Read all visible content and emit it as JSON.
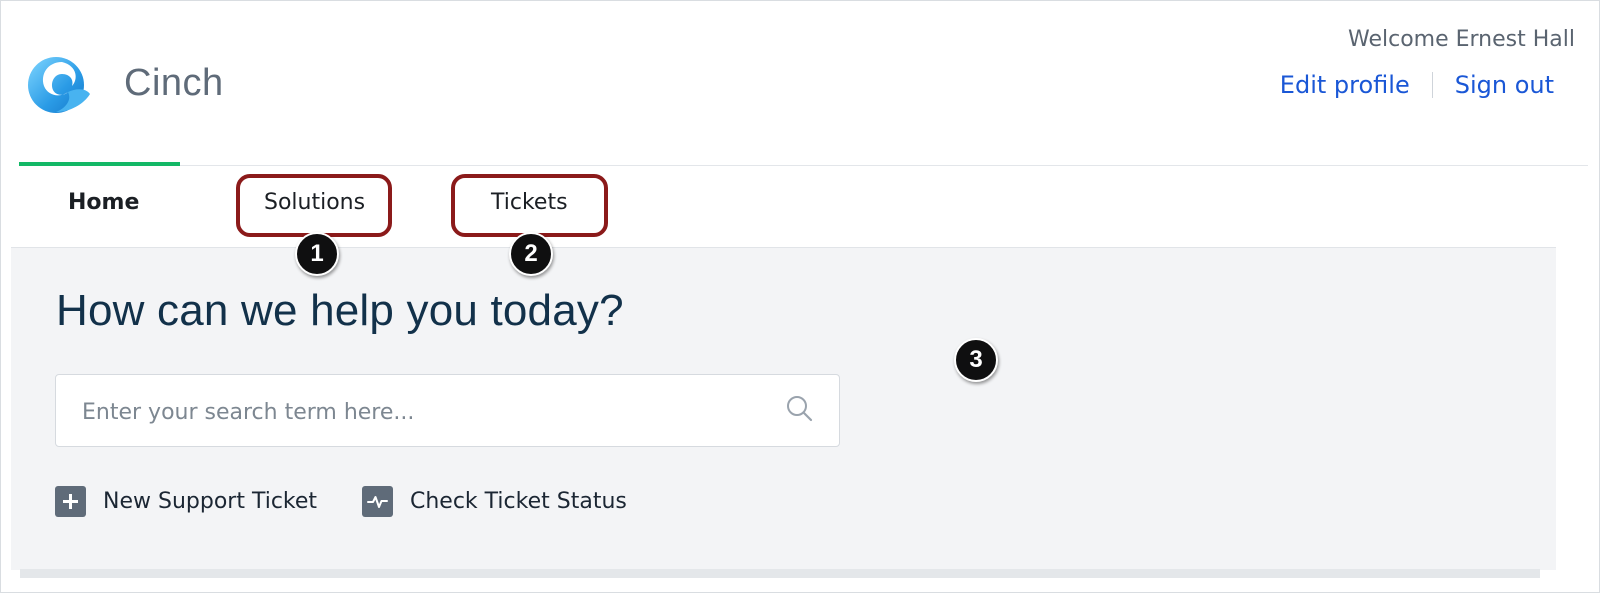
{
  "header": {
    "brand": "Cinch",
    "welcome": "Welcome Ernest Hall",
    "edit_profile": "Edit profile",
    "sign_out": "Sign out",
    "logo_icon": "wave-logo-icon"
  },
  "nav": {
    "tabs": [
      {
        "label": "Home",
        "active": true
      },
      {
        "label": "Solutions",
        "active": false
      },
      {
        "label": "Tickets",
        "active": false
      }
    ],
    "active_color": "#13b866"
  },
  "callouts": {
    "one": "1",
    "two": "2",
    "three": "3",
    "box_color": "#8b1a1a"
  },
  "main": {
    "heading": "How can we help you today?",
    "search": {
      "placeholder": "Enter your search term here...",
      "icon": "search-icon"
    },
    "actions": [
      {
        "label": "New Support Ticket",
        "icon": "plus-icon"
      },
      {
        "label": "Check Ticket Status",
        "icon": "pulse-icon"
      }
    ]
  },
  "colors": {
    "link": "#1a57d6",
    "heading": "#12314a",
    "panel_bg": "#f3f4f6"
  }
}
